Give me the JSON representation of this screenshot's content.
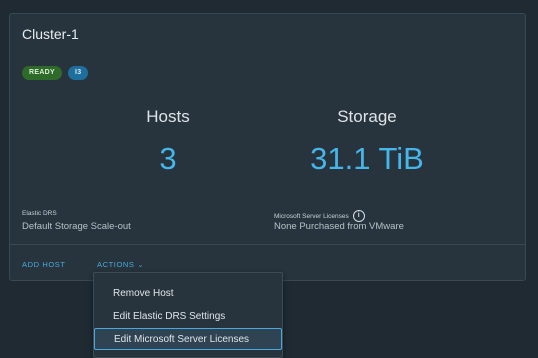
{
  "cluster": {
    "title": "Cluster-1",
    "status_badge": "READY",
    "count_badge": "I3"
  },
  "stats": {
    "hosts_label": "Hosts",
    "hosts_value": "3",
    "storage_label": "Storage",
    "storage_value": "31.1 TiB"
  },
  "meta": {
    "elastic_drs_label": "Elastic DRS",
    "elastic_drs_value": "Default Storage Scale-out",
    "ms_licenses_label": "Microsoft Server Licenses",
    "ms_licenses_value": "None Purchased from VMware"
  },
  "actions": {
    "add_host": "ADD HOST",
    "actions_label": "ACTIONS",
    "menu": [
      {
        "label": "Remove Host"
      },
      {
        "label": "Edit Elastic DRS Settings"
      },
      {
        "label": "Edit Microsoft Server Licenses"
      }
    ]
  },
  "colors": {
    "background": "#1f2a33",
    "card": "#27343d",
    "accent": "#46b5e8",
    "ready_badge": "#2e6b2a",
    "count_badge": "#1f6f9e"
  },
  "icons": {
    "info": "info-icon",
    "chevron": "chevron-down-icon"
  }
}
